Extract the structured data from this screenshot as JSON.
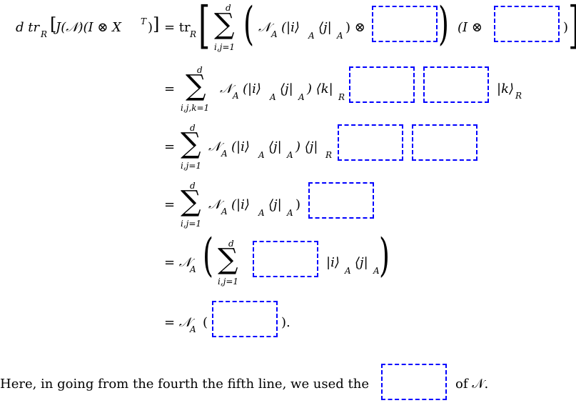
{
  "line1": {
    "lhs": "d tr",
    "lhs_sub": "R",
    "lhs_arg": "J(𝒩)(I ⊗ X",
    "lhs_sup": "T",
    "lhs_close": ")",
    "eq": "= tr",
    "eq_sub": "R",
    "sum_sup": "d",
    "sum_sub": "i,j=1",
    "inner": "𝒩",
    "inner_sub": "A",
    "inner_arg": "(|i⟩",
    "inner_arg_sub": "A",
    "inner_arg2": "⟨j|",
    "inner_arg2_sub": "A",
    "inner_arg_close": ") ⊗",
    "tail_open": "(I ⊗",
    "tail_close": ")"
  },
  "line2": {
    "eq": "=",
    "sum_sup": "d",
    "sum_sub": "i,j,k=1",
    "body": "𝒩",
    "body_sub": "A",
    "arg": "(|i⟩",
    "arg_sub": "A",
    "arg2": "⟨j|",
    "arg2_sub": "A",
    "arg_close": ") ⟨k|",
    "arg_close_sub": "R",
    "ket": "|k⟩",
    "ket_sub": "R"
  },
  "line3": {
    "eq": "=",
    "sum_sup": "d",
    "sum_sub": "i,j=1",
    "body": "𝒩",
    "body_sub": "A",
    "arg": "(|i⟩",
    "arg_sub": "A",
    "arg2": "⟨j|",
    "arg2_sub": "A",
    "arg_close": ") ⟨j|",
    "arg_close_sub": "R"
  },
  "line4": {
    "eq": "=",
    "sum_sup": "d",
    "sum_sub": "i,j=1",
    "body": "𝒩",
    "body_sub": "A",
    "arg": "(|i⟩",
    "arg_sub": "A",
    "arg2": "⟨j|",
    "arg2_sub": "A",
    "arg_close": ")"
  },
  "line5": {
    "eq": "= 𝒩",
    "eq_sub": "A",
    "sum_sup": "d",
    "sum_sub": "i,j=1",
    "ket": "|i⟩",
    "ket_sub": "A",
    "bra": "⟨j|",
    "bra_sub": "A"
  },
  "line6": {
    "eq": "= 𝒩",
    "eq_sub": "A",
    "open": "(",
    "close": ")."
  },
  "sentence": {
    "before": "Here, in going from the fourth the fifth line, we used the",
    "after": "of 𝒩."
  },
  "colors": {
    "blank_border": "#0000ff",
    "text": "#000000"
  }
}
